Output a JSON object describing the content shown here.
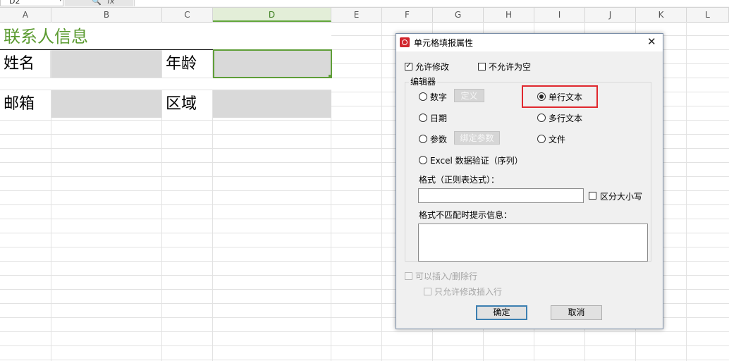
{
  "formula_bar": {
    "name_box": "D2",
    "fx_label": "fx"
  },
  "columns": [
    "A",
    "B",
    "C",
    "D",
    "E",
    "F",
    "G",
    "H",
    "I",
    "J",
    "K",
    "L"
  ],
  "selected_column": "D",
  "sheet": {
    "title": "联系人信息",
    "name_label": "姓名",
    "age_label": "年龄",
    "email_label": "邮箱",
    "region_label": "区域"
  },
  "dialog": {
    "title": "单元格填报属性",
    "allow_edit": {
      "label": "允许修改",
      "checked": true
    },
    "not_empty": {
      "label": "不允许为空",
      "checked": false
    },
    "editor_group_label": "编辑器",
    "editors": {
      "number": {
        "label": "数字",
        "button": "定义"
      },
      "date": {
        "label": "日期"
      },
      "param": {
        "label": "参数",
        "button": "绑定参数"
      },
      "excel": {
        "label": "Excel 数据验证（序列）"
      },
      "single_line": {
        "label": "单行文本",
        "selected": true
      },
      "multi_line": {
        "label": "多行文本"
      },
      "file": {
        "label": "文件"
      }
    },
    "format_label": "格式（正则表达式）：",
    "format_value": "",
    "case_sensitive": {
      "label": "区分大小写",
      "checked": false
    },
    "mismatch_label": "格式不匹配时提示信息：",
    "mismatch_value": "",
    "allow_insert_delete": {
      "label": "可以插入/删除行",
      "checked": false,
      "disabled": true
    },
    "only_edit_insert": {
      "label": "只允许修改插入行",
      "checked": false,
      "disabled": true
    },
    "ok_label": "确定",
    "cancel_label": "取消"
  },
  "colors": {
    "accent_green": "#5a9a2f",
    "highlight_red": "#e0282e",
    "input_gray": "#d9d9d9",
    "dialog_icon_red": "#d1262e"
  }
}
